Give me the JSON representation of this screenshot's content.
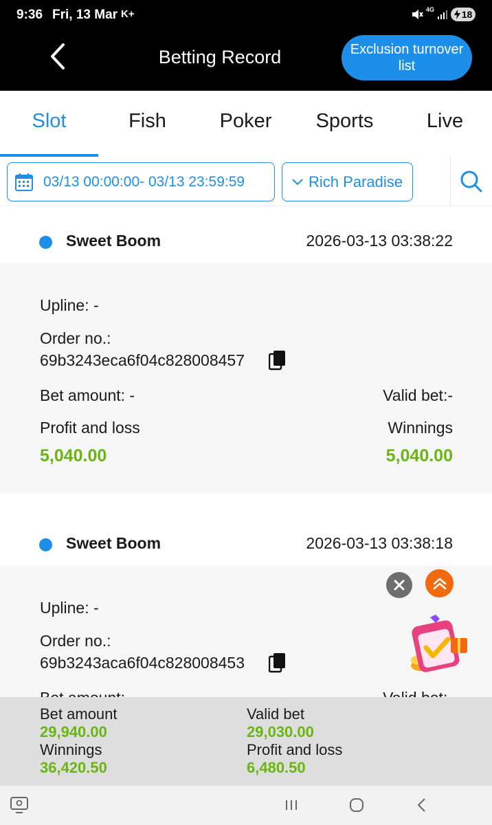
{
  "status_bar": {
    "time": "9:36",
    "date": "Fri, 13 Mar",
    "carrier_icon_label": "K+",
    "network": "4G",
    "battery": "18",
    "icons": [
      "mute-icon",
      "signal-icon",
      "battery-icon"
    ]
  },
  "header": {
    "title": "Betting Record",
    "exclusion_button": "Exclusion turnover list"
  },
  "tabs": [
    {
      "label": "Slot",
      "active": true
    },
    {
      "label": "Fish",
      "active": false
    },
    {
      "label": "Poker",
      "active": false
    },
    {
      "label": "Sports",
      "active": false
    },
    {
      "label": "Live",
      "active": false
    }
  ],
  "filters": {
    "date_range": "03/13 00:00:00- 03/13 23:59:59",
    "game_provider": "Rich Paradise"
  },
  "records": [
    {
      "game": "Sweet Boom",
      "timestamp": "2026-03-13 03:38:22",
      "upline": "Upline: -",
      "order_label": "Order no.:",
      "order_no": "69b3243eca6f04c828008457",
      "bet_amount": "Bet amount: -",
      "valid_bet": "Valid bet:-",
      "profit_label": "Profit and loss",
      "profit_value": "5,040.00",
      "winnings_label": "Winnings",
      "winnings_value": "5,040.00"
    },
    {
      "game": "Sweet Boom",
      "timestamp": "2026-03-13 03:38:18",
      "upline": "Upline: -",
      "order_label": "Order no.:",
      "order_no": "69b3243aca6f04c828008453",
      "bet_amount": "Bet amount: -",
      "valid_bet": "Valid bet:-"
    }
  ],
  "summary": {
    "bet_amount_label": "Bet amount",
    "bet_amount_value": "29,940.00",
    "valid_bet_label": "Valid bet",
    "valid_bet_value": "29,030.00",
    "winnings_label": "Winnings",
    "winnings_value": "36,420.50",
    "profit_label": "Profit and loss",
    "profit_value": "6,480.50"
  },
  "colors": {
    "accent": "#1d8fe8",
    "money": "#6ab512",
    "header_bg": "#000000",
    "scroll_top_button": "#f06a10"
  }
}
